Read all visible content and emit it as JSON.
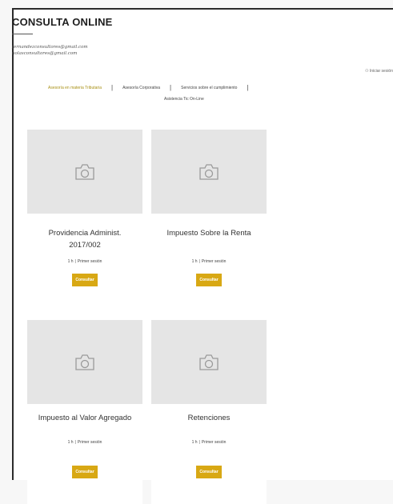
{
  "brand": "CONSULTA ONLINE",
  "emails": [
    "fernandezconsultores@gmail.com",
    "nolasconsultores@gmail.com"
  ],
  "login_label": "Iniciar sesión",
  "nav": {
    "row1": [
      "Asesoría en materia Tributaria",
      "Asesoría Corporativa",
      "Servicios sobre el cumplimiento"
    ],
    "row2": [
      "Asistencia Tic On-Line"
    ]
  },
  "cards": [
    {
      "title": "Providencia Administ. 2017/002",
      "meta_left": "1 h",
      "meta_right": "Primer sesión",
      "button": "Consultar"
    },
    {
      "title": "Impuesto Sobre la Renta",
      "meta_left": "1 h",
      "meta_right": "Primer sesión",
      "button": "Consultar"
    },
    {
      "title": "Impuesto al Valor Agregado",
      "meta_left": "1 h",
      "meta_right": "Primer sesión",
      "button": "Consultar"
    },
    {
      "title": "Retenciones",
      "meta_left": "1 h",
      "meta_right": "Primer sesión",
      "button": "Consultar"
    }
  ],
  "icons": {
    "thumb": "camera-icon",
    "login": "user-icon"
  }
}
